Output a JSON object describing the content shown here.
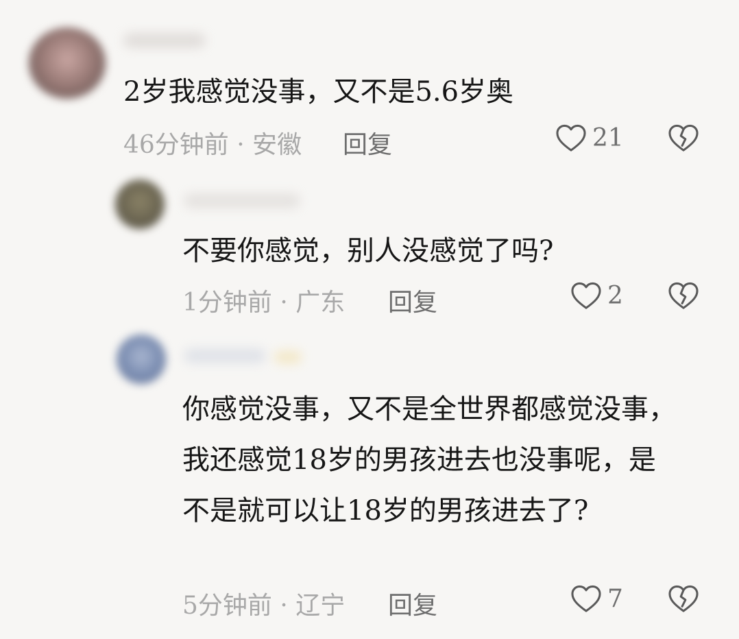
{
  "comments": [
    {
      "text": "2岁我感觉没事，又不是5.6岁奥",
      "meta": "46分钟前 · 安徽",
      "reply_label": "回复",
      "likes": "21"
    },
    {
      "text": "不要你感觉，别人没感觉了吗?",
      "meta": "1分钟前 · 广东",
      "reply_label": "回复",
      "likes": "2"
    },
    {
      "text": "你感觉没事，又不是全世界都感觉没事，我还感觉18岁的男孩进去也没事呢，是不是就可以让18岁的男孩进去了?",
      "meta": "5分钟前 · 辽宁",
      "reply_label": "回复",
      "likes": "7"
    }
  ],
  "icons": {
    "like": "heart-outline-icon",
    "dislike": "broken-heart-icon"
  },
  "colors": {
    "background": "#f7f6f4",
    "text": "#161616",
    "meta": "#a8a8a8",
    "action": "#6e6e6e"
  }
}
